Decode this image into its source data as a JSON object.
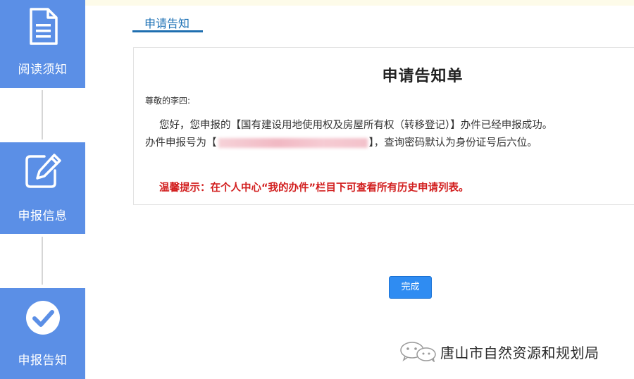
{
  "steps": [
    {
      "label": "阅读须知",
      "icon": "document-icon"
    },
    {
      "label": "申报信息",
      "icon": "edit-icon"
    },
    {
      "label": "申报告知",
      "icon": "check-icon"
    }
  ],
  "tab": {
    "label": "申请告知"
  },
  "notice": {
    "title": "申请告知单",
    "salutation": "尊敬的李四:",
    "line1": "您好，您申报的【国有建设用地使用权及房屋所有权（转移登记）】办件已经申报成功。",
    "line2_prefix": "办件申报号为【",
    "line2_suffix": "】，查询密码默认为身份证号后六位。",
    "hint": "温馨提示：在个人中心“我的办件”栏目下可查看所有历史申请列表。"
  },
  "done_button": {
    "label": "完成"
  },
  "watermark": {
    "text": "唐山市自然资源和规划局",
    "icon": "wechat-icon"
  },
  "colors": {
    "step_bg": "#5b8fe6",
    "tab_accent": "#1f6fb0",
    "hint_red": "#d21f1f",
    "button_blue": "#2f8cf2"
  }
}
